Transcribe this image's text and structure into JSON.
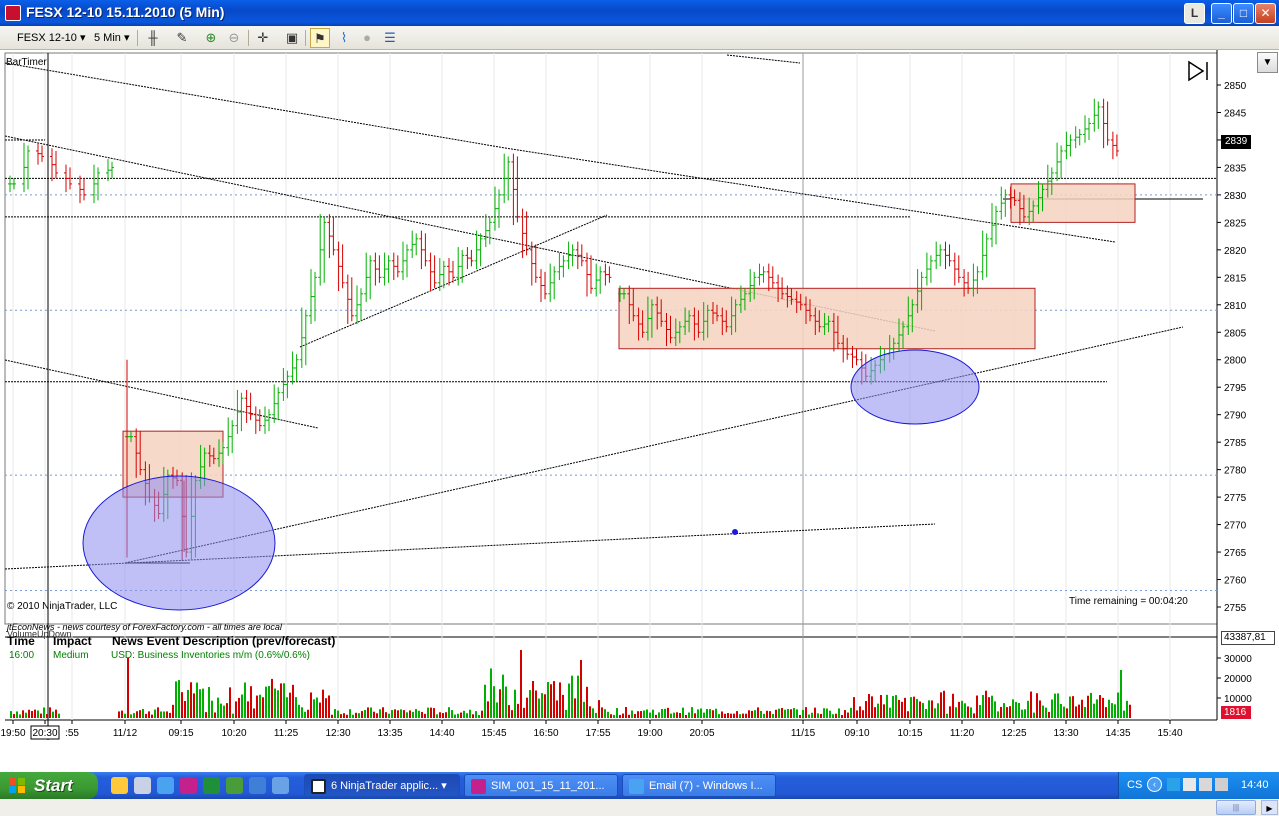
{
  "window": {
    "title": "FESX 12-10  15.11.2010 (5 Min)",
    "buttons": [
      "L",
      "_",
      "□",
      "✕"
    ]
  },
  "toolbar": {
    "instrument": "FESX 12-10",
    "interval": "5 Min"
  },
  "chart": {
    "indicator_label": "BarTimer",
    "copyright": "© 2010 NinjaTrader, LLC",
    "time_remaining": "Time remaining = 00:04:20",
    "current_price": "2839",
    "econ_news_credit": "jtEconNews - news courtesy of ForexFactory.com - all times are local",
    "volume_panel_label": "VolumeUpDown",
    "volume_current": "43387,81",
    "volume_last": "1816"
  },
  "news_table": {
    "headers": [
      "Time",
      "Impact",
      "News Event Description (prev/forecast)"
    ],
    "rows": [
      {
        "time": "16:00",
        "impact": "Medium",
        "description": "USD: Business Inventories m/m (0.6%/0.6%)"
      }
    ]
  },
  "chart_data": {
    "type": "candlestick",
    "title": "",
    "price_axis": {
      "ticks": [
        2850,
        2845,
        2840,
        2835,
        2830,
        2825,
        2820,
        2815,
        2810,
        2805,
        2800,
        2795,
        2790,
        2785,
        2780,
        2775,
        2770,
        2765,
        2760,
        2755
      ],
      "range": [
        2754,
        2853
      ]
    },
    "volume_axis": {
      "ticks": [
        30000,
        20000,
        10000
      ],
      "labels": [
        "30000",
        "20000",
        "10000"
      ],
      "range": [
        0,
        36000
      ]
    },
    "time_axis": {
      "labels": [
        "19:50",
        "20:30",
        ":55",
        "11/12",
        "09:15",
        "10:20",
        "11:25",
        "12:30",
        "13:35",
        "14:40",
        "15:45",
        "16:50",
        "17:55",
        "19:00",
        "20:05",
        "11/15",
        "09:10",
        "10:15",
        "11:20",
        "12:25",
        "13:30",
        "14:35",
        "15:40"
      ]
    },
    "price_path": [
      [
        2832,
        2838,
        2837,
        2834,
        2832,
        2830,
        2834,
        2835
      ],
      [
        2786,
        2780,
        2775,
        2772,
        2779,
        2778,
        2765,
        2778,
        2783,
        2782,
        2784,
        2788,
        2793,
        2790,
        2788,
        2790,
        2794,
        2797,
        2800,
        2808,
        2815,
        2825,
        2820,
        2814,
        2808,
        2812,
        2818,
        2815,
        2818,
        2816,
        2820,
        2822,
        2818,
        2814,
        2817,
        2815,
        2819,
        2818,
        2822,
        2825,
        2830,
        2836,
        2826,
        2820,
        2815,
        2812,
        2816,
        2818,
        2820,
        2818,
        2813,
        2816,
        2815
      ],
      [
        2812,
        2808,
        2805,
        2810,
        2807,
        2804,
        2806,
        2808,
        2805,
        2809,
        2808,
        2806,
        2810,
        2812,
        2815,
        2816,
        2814,
        2812,
        2811,
        2810,
        2808,
        2806,
        2807,
        2803,
        2801,
        2800,
        2797,
        2799,
        2801,
        2803,
        2806,
        2810,
        2815,
        2818,
        2820,
        2818,
        2815,
        2813,
        2816,
        2822,
        2827,
        2830,
        2829,
        2826,
        2828,
        2831,
        2834,
        2838,
        2840,
        2841,
        2843,
        2846,
        2840,
        2838
      ]
    ],
    "horizontal_lines": [
      2840,
      2833,
      2826,
      2796
    ],
    "dotted_blue_lines": [
      2830,
      2809,
      2779,
      2758
    ],
    "zones": [
      {
        "name": "zone-early",
        "price_top": 2787,
        "price_bottom": 2775
      },
      {
        "name": "zone-midday",
        "price_top": 2813,
        "price_bottom": 2802
      },
      {
        "name": "zone-top",
        "price_top": 2832,
        "price_bottom": 2825
      }
    ],
    "ellipses": [
      "low-area-early",
      "low-area-late"
    ],
    "colors": {
      "up": "#00b000",
      "down": "#d40000",
      "zone_fill": "#f6d2bf",
      "zone_stroke": "#b22222",
      "ellipse_fill": "#8f8ff0",
      "ellipse_stroke": "#1a1ad8",
      "price_marker": "#000000",
      "volume_marker": "#e0102f"
    }
  },
  "taskbar": {
    "start_label": "Start",
    "tasks": [
      {
        "label": "6 NinjaTrader applic...",
        "active": true
      },
      {
        "label": "SIM_001_15_11_201...",
        "active": false
      },
      {
        "label": "Email (7) - Windows I...",
        "active": false
      }
    ],
    "tray": {
      "lang": "CS",
      "time": "14:40"
    }
  }
}
